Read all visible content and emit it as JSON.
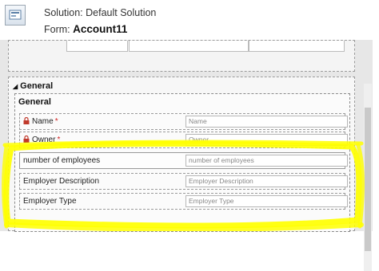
{
  "header": {
    "solution_title": "Solution: Default Solution",
    "form_label": "Form:",
    "form_name": "Account11"
  },
  "tab": {
    "title": "General"
  },
  "section": {
    "title": "General"
  },
  "fields": [
    {
      "label": "Name",
      "required": "*",
      "placeholder": "Name",
      "locked": true
    },
    {
      "label": "Owner",
      "required": "*",
      "placeholder": "Owner",
      "locked": true
    },
    {
      "label": "number of employees",
      "required": "",
      "placeholder": "number of employees",
      "locked": false
    },
    {
      "label": "Employer Description",
      "required": "",
      "placeholder": "Employer Description",
      "locked": false
    },
    {
      "label": "Employer Type",
      "required": "",
      "placeholder": "Employer Type",
      "locked": false
    }
  ],
  "colors": {
    "highlight": "#ffff00",
    "required": "#d21f1f",
    "lock": "#c0392b"
  },
  "icons": {
    "app": "solution-icon",
    "lock": "lock-icon",
    "collapse": "triangle-down-icon"
  }
}
